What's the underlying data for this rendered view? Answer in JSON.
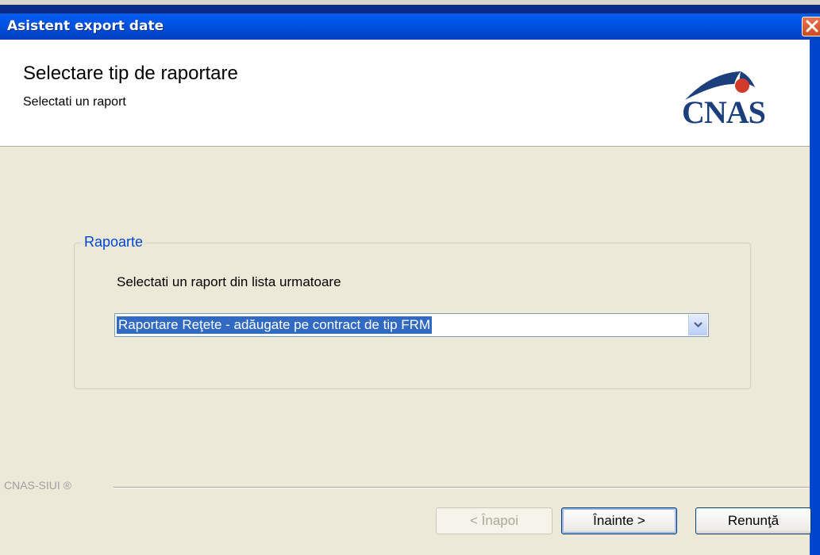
{
  "window": {
    "title": "Asistent export date"
  },
  "header": {
    "title": "Selectare tip de raportare",
    "subtitle": "Selectati un raport",
    "logo_text": "CNAS"
  },
  "group": {
    "legend": "Rapoarte",
    "prompt": "Selectati un raport din lista urmatoare",
    "selected_report": "Raportare Reţete - adăugate pe contract de tip FRM"
  },
  "footer": {
    "brand": "CNAS-SIUI ®",
    "back_label": "< Înapoi",
    "next_label": "Înainte >",
    "cancel_label": "Renunţă"
  },
  "colors": {
    "titlebar": "#0054e3",
    "accent_text": "#0046d5",
    "selection": "#316ac5",
    "background": "#ece9d8"
  },
  "icons": {
    "close": "close-icon",
    "dropdown": "chevron-down-icon",
    "logo": "cnas-logo"
  }
}
